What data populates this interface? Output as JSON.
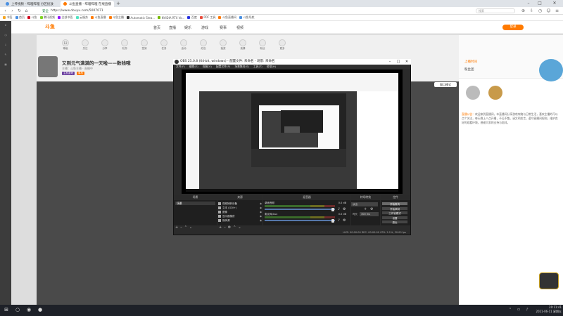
{
  "browser": {
    "tabs": [
      {
        "label": "上传视频 - 哔哩哔哩 分区投放",
        "active": false
      },
      {
        "label": "斗鱼直播 - 哔哩哔哩 在线直播",
        "active": true
      }
    ],
    "url": "https://www.douyu.com/5007071",
    "url_prefix": "安全",
    "bookmarks": [
      "书签",
      "首页",
      "斗鱼",
      "腾讯视频",
      "全部书签",
      "云服务",
      "斗鱼直播",
      "斗鱼主播",
      "Automatic Stea...",
      "NVIDIA RTX Vo...",
      "百度",
      "PDF 工具",
      "斗鱼直播间",
      "斗鱼导航"
    ],
    "search_placeholder": "搜索"
  },
  "site": {
    "logo": "斗鱼",
    "nav": [
      "首页",
      "直播",
      "娱乐",
      "游戏",
      "赛事",
      "视频"
    ],
    "login": "登录",
    "icons": [
      {
        "label": "12",
        "sub": "等级"
      },
      {
        "label": "",
        "sub": "关注"
      },
      {
        "label": "",
        "sub": "分享"
      },
      {
        "label": "",
        "sub": "礼物"
      },
      {
        "label": "",
        "sub": "签到"
      },
      {
        "label": "",
        "sub": "任务"
      },
      {
        "label": "",
        "sub": "活动"
      },
      {
        "label": "",
        "sub": "红包"
      },
      {
        "label": "",
        "sub": "抽奖"
      },
      {
        "label": "",
        "sub": "竞猜"
      },
      {
        "label": "",
        "sub": "粉丝"
      },
      {
        "label": "",
        "sub": "更多"
      }
    ],
    "stream_title": "又到元气满满的一天啦——数钱哦",
    "stream_meta": "主播：斗鱼主播 · 直播中",
    "tags": [
      "主机游戏",
      "单机"
    ],
    "switch_btn": "窗口模式",
    "rp_b1": "上播时间",
    "rp_b2": "粉丝团",
    "notice_head": "直播公告：",
    "notice_body": "欢迎来到直播间，本直播间分享游戏攻略与日常生活，喜欢主播的可以点个关注，每天晚上八点开播，不见不散。请文明发言，遵守直播间规则，维护良好的观看环境，感谢大家的支持与陪伴。"
  },
  "obs": {
    "title": "OBS 25.0.8 (64-bit, windows) - 配置文件: 未命名 - 场景: 未命名",
    "menu": [
      "文件(F)",
      "编辑(E)",
      "视图(V)",
      "配置文件(P)",
      "场景集合(S)",
      "工具(T)",
      "帮助(H)"
    ],
    "docks": {
      "scenes": "场景",
      "sources": "来源",
      "mixer": "混音器",
      "transitions": "转场特效",
      "controls": "控件"
    },
    "scene_items": [
      "场景"
    ],
    "sources": [
      {
        "name": "视频捕获设备",
        "vis": "◉"
      },
      {
        "name": "文本 (GDI+)",
        "vis": "◉"
      },
      {
        "name": "图像",
        "vis": "◉"
      },
      {
        "name": "显示器捕获",
        "vis": "◉"
      },
      {
        "name": "媒体源",
        "vis": "◉"
      }
    ],
    "mixer": [
      {
        "name": "桌面音频",
        "db": "0.0 dB"
      },
      {
        "name": "麦克风/Aux",
        "db": "0.0 dB"
      }
    ],
    "transition": "淡出",
    "duration_label": "时长",
    "duration": "300 ms",
    "controls": [
      "开始推流",
      "开始录制",
      "工作室模式",
      "设置",
      "退出"
    ],
    "status": "LIVE: 00:00:00   REC: 00:00:00   CPU: 2.1%, 30.00 fps"
  },
  "taskbar": {
    "time": "20:11:41",
    "date": "2021-06-11 星期五"
  }
}
